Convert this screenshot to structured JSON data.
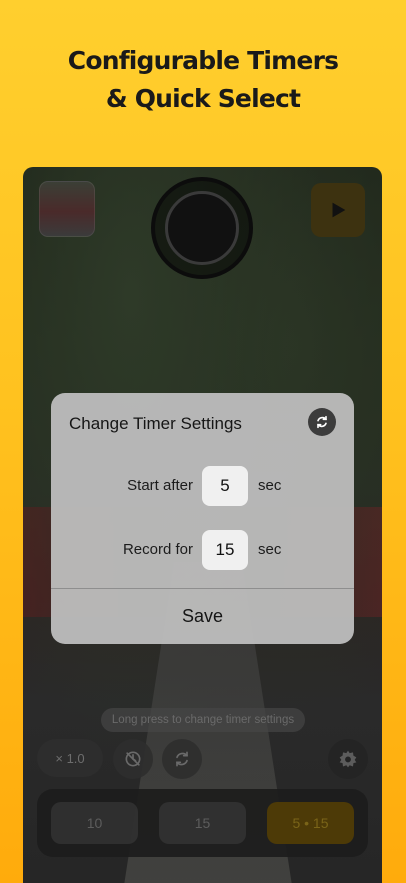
{
  "headline": {
    "line1": "Configurable Timers",
    "line2": "& Quick Select"
  },
  "camera": {
    "hint": "Long press to change timer settings",
    "zoom_label": "× 1.0",
    "presets": [
      {
        "label": "10",
        "active": false
      },
      {
        "label": "15",
        "active": false
      },
      {
        "label": "5 • 15",
        "active": true
      }
    ],
    "accent_color": "#ffc21f"
  },
  "dialog": {
    "title": "Change Timer Settings",
    "start_label": "Start after",
    "start_value": "5",
    "record_label": "Record for",
    "record_value": "15",
    "unit": "sec",
    "save_label": "Save"
  },
  "icons": [
    "play-icon",
    "timer-off-icon",
    "flip-camera-icon",
    "gear-icon",
    "reset-icon"
  ]
}
